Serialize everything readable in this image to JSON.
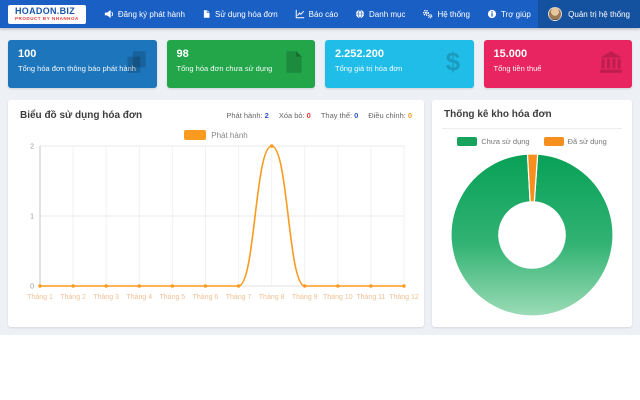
{
  "navbar": {
    "logo": {
      "title": "HOADON.BIZ",
      "subtitle": "PRODUCT BY NHANHOA"
    },
    "menu": [
      {
        "label": "Đăng ký phát hành",
        "icon": "bullhorn-icon"
      },
      {
        "label": "Sử dụng hóa đơn",
        "icon": "file-icon"
      },
      {
        "label": "Báo cáo",
        "icon": "chart-line-icon"
      },
      {
        "label": "Danh mục",
        "icon": "globe-icon"
      },
      {
        "label": "Hệ thống",
        "icon": "cogs-icon"
      },
      {
        "label": "Trợ giúp",
        "icon": "info-icon"
      }
    ],
    "user": {
      "label": "Quản trị hệ thống",
      "icon": "avatar"
    }
  },
  "cards": [
    {
      "value": "100",
      "label": "Tổng hóa đơn thông báo phát hành",
      "color": "#1d76bb",
      "icon": "copy-files-icon"
    },
    {
      "value": "98",
      "label": "Tổng hóa đơn chưa sử dụng",
      "color": "#23a64a",
      "icon": "file-solid-icon"
    },
    {
      "value": "2.252.200",
      "label": "Tổng giá trị hóa đơn",
      "color": "#20bde9",
      "icon": "dollar-icon"
    },
    {
      "value": "15.000",
      "label": "Tổng tiền thuế",
      "color": "#e82560",
      "icon": "bank-icon"
    }
  ],
  "chart_panel": {
    "title": "Biểu đồ sử dụng hóa đơn",
    "stats": [
      {
        "label": "Phát hành:",
        "value": "2",
        "color": "#2b57c8"
      },
      {
        "label": "Xóa bỏ:",
        "value": "0",
        "color": "#e53935"
      },
      {
        "label": "Thay thế:",
        "value": "0",
        "color": "#2b57c8"
      },
      {
        "label": "Điều chỉnh:",
        "value": "0",
        "color": "#f59a23"
      }
    ],
    "legend": "Phát hành"
  },
  "donut_panel": {
    "title": "Thống kê kho hóa đơn",
    "legend": [
      {
        "label": "Chưa sử dụng",
        "color": "#17a35b"
      },
      {
        "label": "Đã sử dụng",
        "color": "#f78f1e"
      }
    ]
  },
  "chart_data": [
    {
      "type": "line",
      "title": "Biểu đồ sử dụng hóa đơn",
      "categories": [
        "Tháng 1",
        "Tháng 2",
        "Tháng 3",
        "Tháng 4",
        "Tháng 5",
        "Tháng 6",
        "Tháng 7",
        "Tháng 8",
        "Tháng 9",
        "Tháng 10",
        "Tháng 11",
        "Tháng 12"
      ],
      "series": [
        {
          "name": "Phát hành",
          "color": "#fa9a1f",
          "values": [
            0,
            0,
            0,
            0,
            0,
            0,
            0,
            2,
            0,
            0,
            0,
            0
          ]
        }
      ],
      "xlabel": "",
      "ylabel": "",
      "ylim": [
        0,
        2
      ],
      "yticks": [
        0,
        1,
        2
      ],
      "smooth": true,
      "grid": true,
      "legend_position": "top"
    },
    {
      "type": "pie",
      "subtype": "donut",
      "title": "Thống kê kho hóa đơn",
      "labels": [
        "Chưa sử dụng",
        "Đã sử dụng"
      ],
      "values": [
        98,
        2
      ],
      "colors": [
        "#17a35b",
        "#f78f1e"
      ],
      "hole": 0.41,
      "rotation": -86,
      "legend_position": "top"
    }
  ]
}
